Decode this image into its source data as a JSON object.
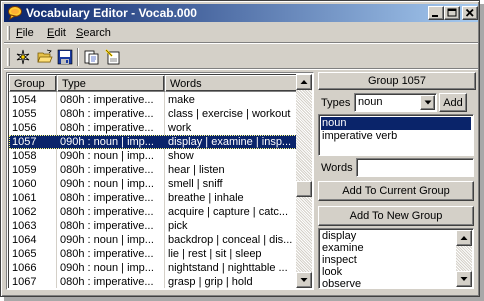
{
  "window": {
    "title": "Vocabulary Editor - Vocab.000",
    "icon": "speech-bubble-icon",
    "controls": [
      "minimize-icon",
      "maximize-icon",
      "close-icon"
    ]
  },
  "menu": {
    "file": {
      "accel": "F",
      "rest": "ile"
    },
    "edit": {
      "accel": "E",
      "rest": "dit"
    },
    "search": {
      "accel": "S",
      "rest": "earch"
    }
  },
  "toolbar": {
    "tools": [
      "new-icon",
      "open-folder-icon",
      "save-icon",
      "export-icon",
      "properties-icon"
    ]
  },
  "list": {
    "columns": [
      "Group",
      "Type",
      "Words"
    ],
    "selected_index": 3,
    "rows": [
      {
        "group": "1054",
        "type": "080h : imperative...",
        "words": "make"
      },
      {
        "group": "1055",
        "type": "080h : imperative...",
        "words": "class | exercise | workout"
      },
      {
        "group": "1056",
        "type": "080h : imperative...",
        "words": "work"
      },
      {
        "group": "1057",
        "type": "090h : noun | imp...",
        "words": "display | examine | insp..."
      },
      {
        "group": "1058",
        "type": "090h : noun | imp...",
        "words": "show"
      },
      {
        "group": "1059",
        "type": "080h : imperative...",
        "words": "hear | listen"
      },
      {
        "group": "1060",
        "type": "090h : noun | imp...",
        "words": "smell | sniff"
      },
      {
        "group": "1061",
        "type": "080h : imperative...",
        "words": "breathe | inhale"
      },
      {
        "group": "1062",
        "type": "080h : imperative...",
        "words": "acquire | capture | catc..."
      },
      {
        "group": "1063",
        "type": "080h : imperative...",
        "words": "pick"
      },
      {
        "group": "1064",
        "type": "090h : noun | imp...",
        "words": "backdrop | conceal | dis..."
      },
      {
        "group": "1065",
        "type": "080h : imperative...",
        "words": "lie | rest | sit | sleep"
      },
      {
        "group": "1066",
        "type": "090h : noun | imp...",
        "words": "nightstand | nighttable ..."
      },
      {
        "group": "1067",
        "type": "080h : imperative...",
        "words": "grasp | grip | hold"
      }
    ],
    "scroll_position": 0.55
  },
  "panel": {
    "group_title": "Group 1057",
    "types_label": "Types",
    "types_value": "noun",
    "add_label": "Add",
    "type_items": [
      "noun",
      "imperative verb"
    ],
    "type_selected": 0,
    "words_label": "Words",
    "words_value": "",
    "add_current_label": "Add To Current Group",
    "add_new_label": "Add To New Group",
    "word_items": [
      "display",
      "examine",
      "inspect",
      "look",
      "observe"
    ]
  }
}
